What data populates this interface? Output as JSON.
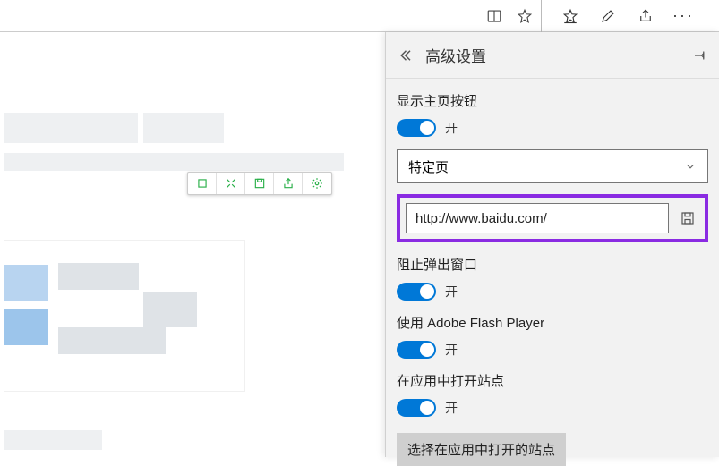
{
  "panel": {
    "title": "高级设置",
    "home_button": {
      "label": "显示主页按钮",
      "state": "开"
    },
    "page_select": {
      "selected": "特定页"
    },
    "home_url": {
      "value": "http://www.baidu.com/"
    },
    "popup_block": {
      "label": "阻止弹出窗口",
      "state": "开"
    },
    "flash": {
      "label": "使用 Adobe Flash Player",
      "state": "开"
    },
    "open_in_app": {
      "label": "在应用中打开站点",
      "state": "开"
    },
    "choose_sites_btn": "选择在应用中打开的站点"
  }
}
